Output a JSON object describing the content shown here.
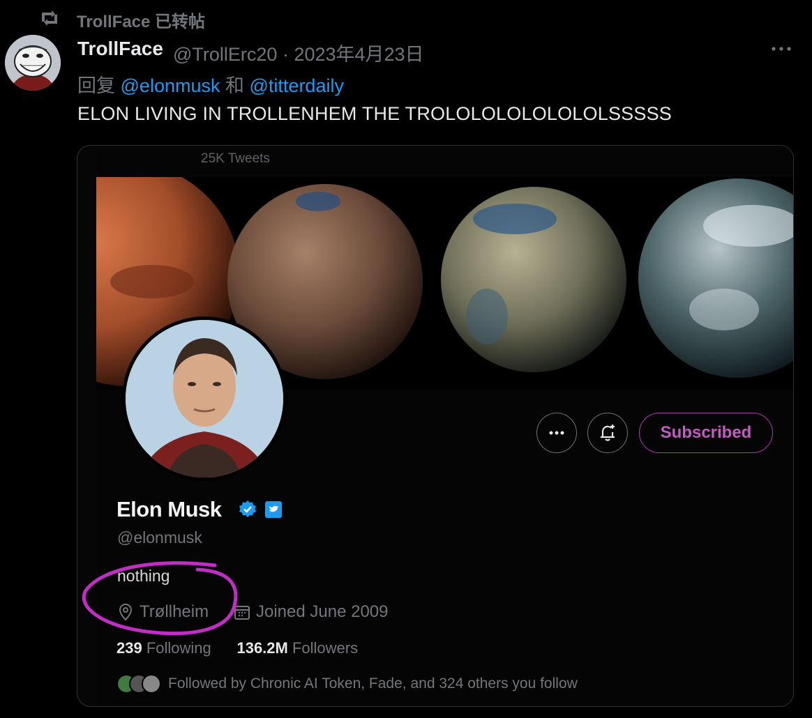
{
  "repost": {
    "text": "TrollFace 已转帖"
  },
  "tweet": {
    "author_name": "TrollFace",
    "author_handle_date": "@TrollErc20 · 2023年4月23日",
    "reply_prefix": "回复",
    "reply_mention_1": "@elonmusk",
    "reply_conj": "和",
    "reply_mention_2": "@titterdaily",
    "text": "ELON LIVING IN TROLLENHEM THE TROLOLOLOLOLOLOLSSSSS"
  },
  "profile": {
    "tweets_count": "25K Tweets",
    "subscribed_label": "Subscribed",
    "name": "Elon Musk",
    "handle": "@elonmusk",
    "bio": "nothing",
    "location": "Trøllheim",
    "joined": "Joined June 2009",
    "following_count": "239",
    "following_label": "Following",
    "followers_count": "136.2M",
    "followers_label": "Followers",
    "followed_by": "Followed by Chronic AI Token, Fade, and 324 others you follow"
  },
  "colors": {
    "mention": "#1d9bf0",
    "subscribed": "#c45ac4",
    "annotation": "#c02ec4"
  }
}
